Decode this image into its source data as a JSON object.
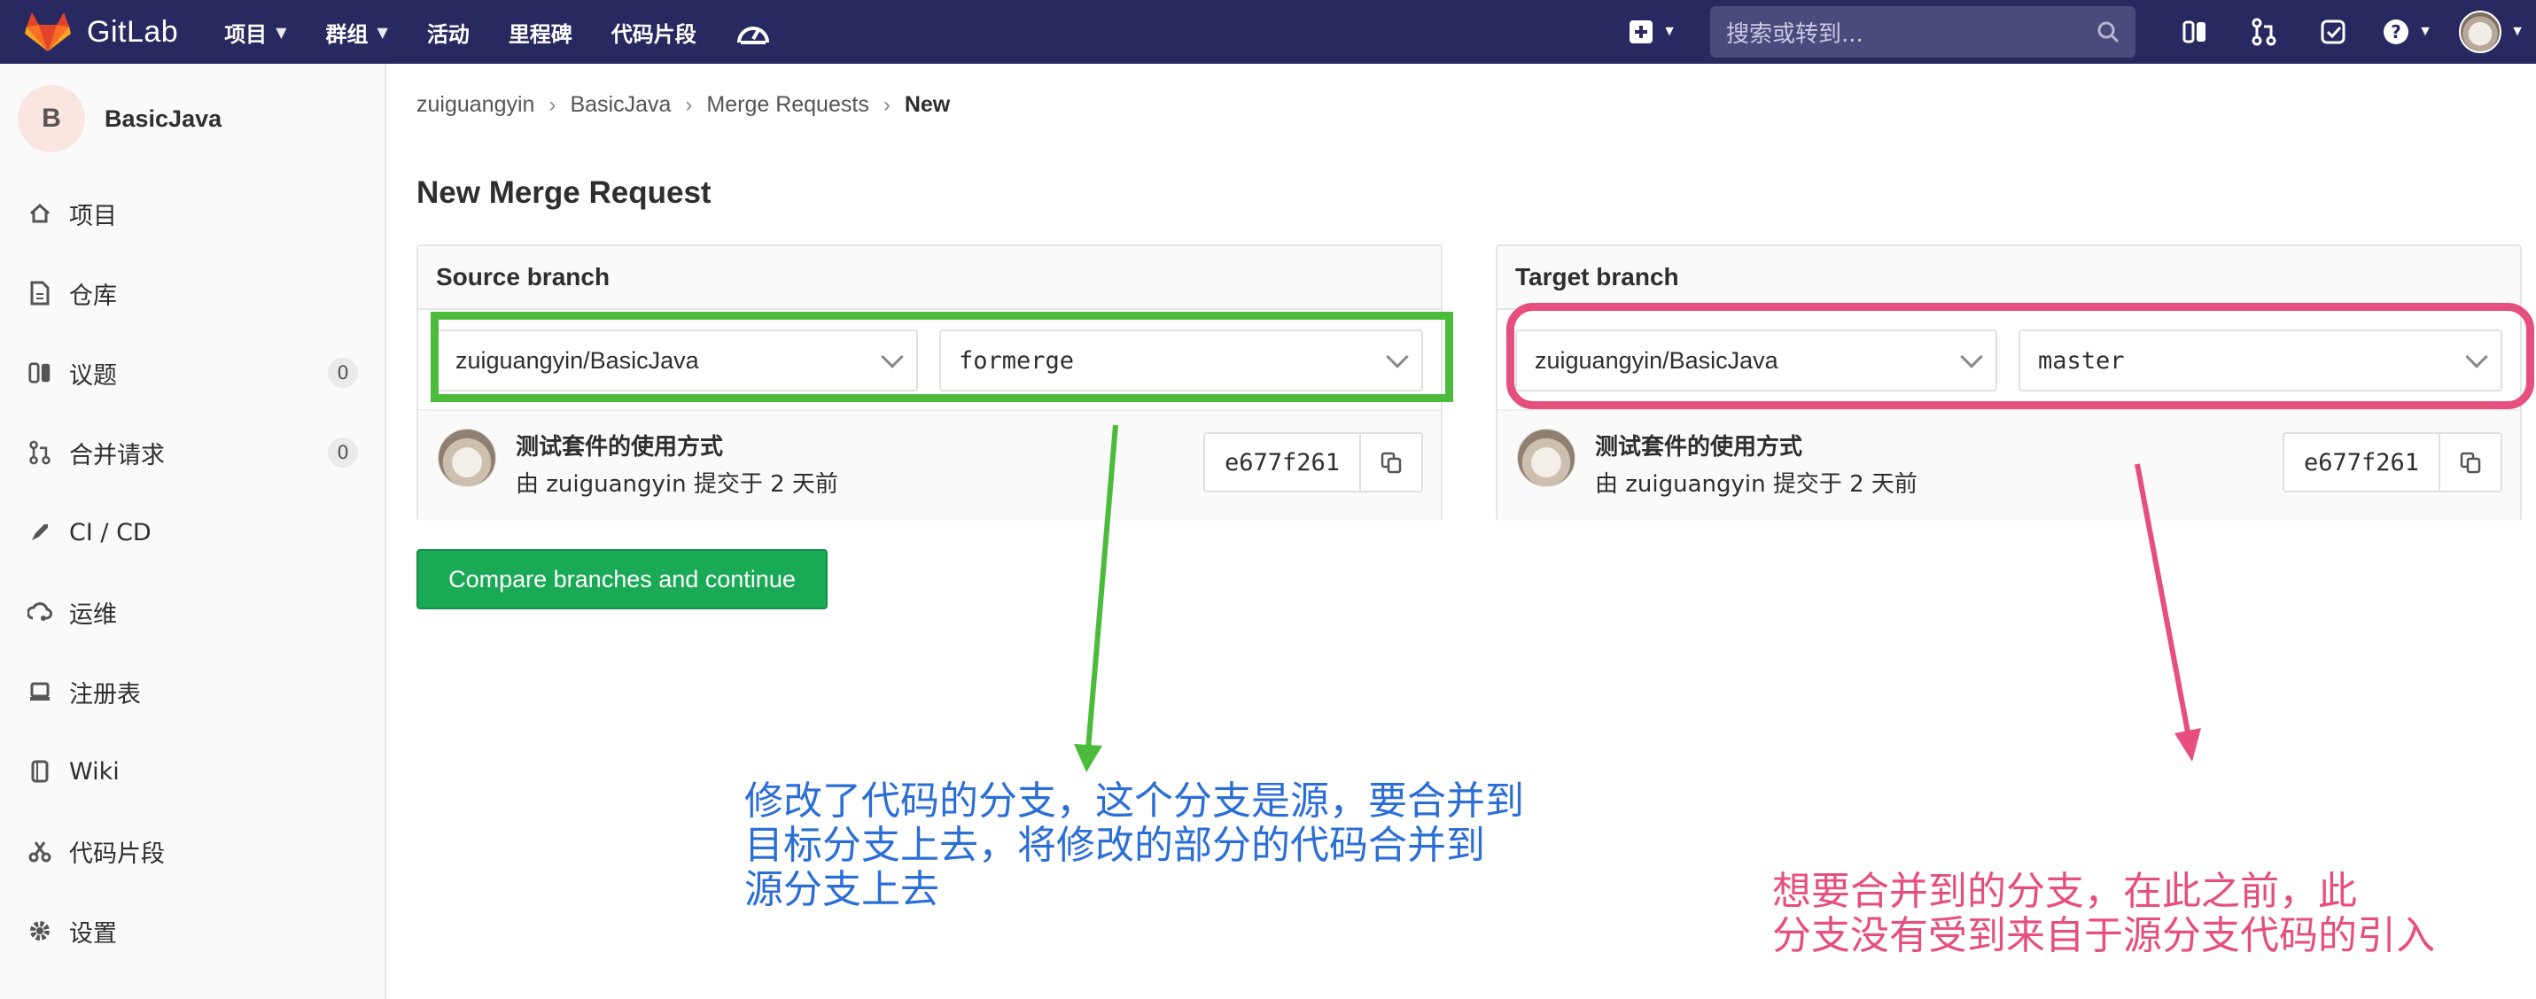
{
  "navbar": {
    "brand": "GitLab",
    "menu": [
      {
        "label": "项目",
        "caret": true
      },
      {
        "label": "群组",
        "caret": true
      },
      {
        "label": "活动",
        "caret": false
      },
      {
        "label": "里程碑",
        "caret": false
      },
      {
        "label": "代码片段",
        "caret": false
      }
    ],
    "search_placeholder": "搜索或转到...",
    "icons": [
      "speedometer-icon",
      "plus-square-icon",
      "search-icon",
      "issues-icon",
      "merge-request-icon",
      "todo-check-icon",
      "help-icon",
      "user-avatar"
    ]
  },
  "sidebar": {
    "project_initial": "B",
    "project_name": "BasicJava",
    "items": [
      {
        "label": "项目",
        "icon": "home-icon"
      },
      {
        "label": "仓库",
        "icon": "file-icon"
      },
      {
        "label": "议题",
        "icon": "issues-icon",
        "badge": "0"
      },
      {
        "label": "合并请求",
        "icon": "merge-request-icon",
        "badge": "0"
      },
      {
        "label": "CI / CD",
        "icon": "rocket-icon"
      },
      {
        "label": "运维",
        "icon": "cloud-gear-icon"
      },
      {
        "label": "注册表",
        "icon": "container-icon"
      },
      {
        "label": "Wiki",
        "icon": "book-icon"
      },
      {
        "label": "代码片段",
        "icon": "scissors-icon"
      },
      {
        "label": "设置",
        "icon": "gear-icon"
      }
    ]
  },
  "breadcrumb": [
    "zuiguangyin",
    "BasicJava",
    "Merge Requests",
    "New"
  ],
  "page_title": "New Merge Request",
  "source": {
    "heading": "Source branch",
    "project": "zuiguangyin/BasicJava",
    "branch": "formerge",
    "commit_title": "测试套件的使用方式",
    "commit_meta": "由 zuiguangyin 提交于 2 天前",
    "sha": "e677f261"
  },
  "target": {
    "heading": "Target branch",
    "project": "zuiguangyin/BasicJava",
    "branch": "master",
    "commit_title": "测试套件的使用方式",
    "commit_meta": "由 zuiguangyin 提交于 2 天前",
    "sha": "e677f261"
  },
  "compare_button": "Compare branches and continue",
  "annotations": {
    "source_note": "修改了代码的分支，这个分支是源，要合并到\n目标分支上去，将修改的部分的代码合并到\n源分支上去",
    "target_note": "想要合并到的分支，在此之前，此\n分支没有受到来自于源分支代码的引入",
    "colors": {
      "green": "#4cbb3c",
      "pink": "#e64e7e",
      "blue": "#2b6ed6"
    }
  }
}
